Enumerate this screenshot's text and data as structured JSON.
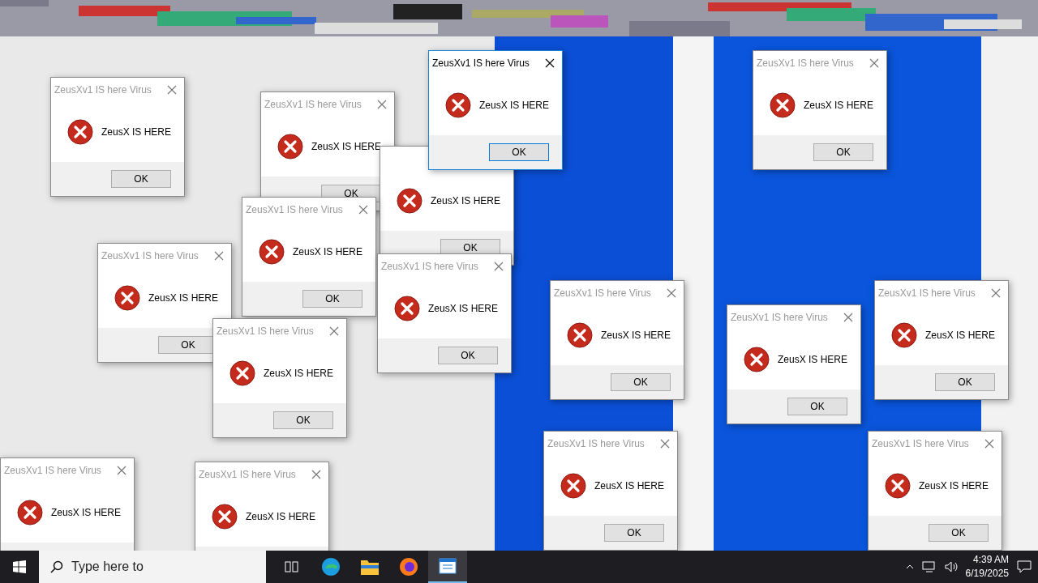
{
  "dialogs": [
    {
      "title": "ZeusXv1 IS here Virus",
      "message": "ZeusX IS HERE",
      "button": "OK",
      "active": false
    },
    {
      "title": "ZeusXv1 IS here Virus",
      "message": "ZeusX IS HERE",
      "button": "OK",
      "active": false
    },
    {
      "title": "ZeusXv1 IS here Virus",
      "message": "ZeusX IS HERE",
      "button": "OK",
      "active": true
    },
    {
      "title": "ZeusXv1 IS here Virus",
      "message": "ZeusX IS HERE",
      "button": "OK",
      "active": false
    },
    {
      "message": "ZeusX IS HERE",
      "button": "OK",
      "active": false
    },
    {
      "title": "ZeusXv1 IS here Virus",
      "message": "ZeusX IS HERE",
      "button": "OK",
      "active": false
    },
    {
      "title": "ZeusXv1 IS here Virus",
      "message": "ZeusX IS HERE",
      "button": "OK",
      "active": false
    },
    {
      "title": "ZeusXv1 IS here Virus",
      "message": "ZeusX IS HERE",
      "button": "OK",
      "active": false
    },
    {
      "title": "ZeusXv1 IS here Virus",
      "message": "ZeusX IS HERE",
      "button": "OK",
      "active": false
    },
    {
      "title": "ZeusXv1 IS here Virus",
      "message": "ZeusX IS HERE",
      "button": "OK",
      "active": false
    },
    {
      "title": "ZeusXv1 IS here Virus",
      "message": "ZeusX IS HERE",
      "button": "OK",
      "active": false
    },
    {
      "title": "ZeusXv1 IS here Virus",
      "message": "ZeusX IS HERE",
      "button": "OK",
      "active": false
    },
    {
      "title": "ZeusXv1 IS here Virus",
      "message": "ZeusX IS HERE",
      "active": false
    },
    {
      "title": "ZeusXv1 IS here Virus",
      "message": "ZeusX IS HERE",
      "active": false
    },
    {
      "title": "ZeusXv1 IS here Virus",
      "message": "ZeusX IS HERE",
      "button": "OK",
      "active": false
    },
    {
      "title": "ZeusXv1 IS here Virus",
      "message": "ZeusX IS HERE",
      "button": "OK",
      "active": false
    }
  ],
  "taskbar": {
    "search": {
      "placeholder": "Type here to"
    },
    "apps": [
      {
        "kind": "taskview",
        "selected": false
      },
      {
        "kind": "edge",
        "selected": false
      },
      {
        "kind": "explorer",
        "selected": false
      },
      {
        "kind": "firefox",
        "selected": false
      },
      {
        "kind": "notepad",
        "selected": true
      }
    ],
    "time": "4:39 AM",
    "date": "6/19/2025"
  }
}
